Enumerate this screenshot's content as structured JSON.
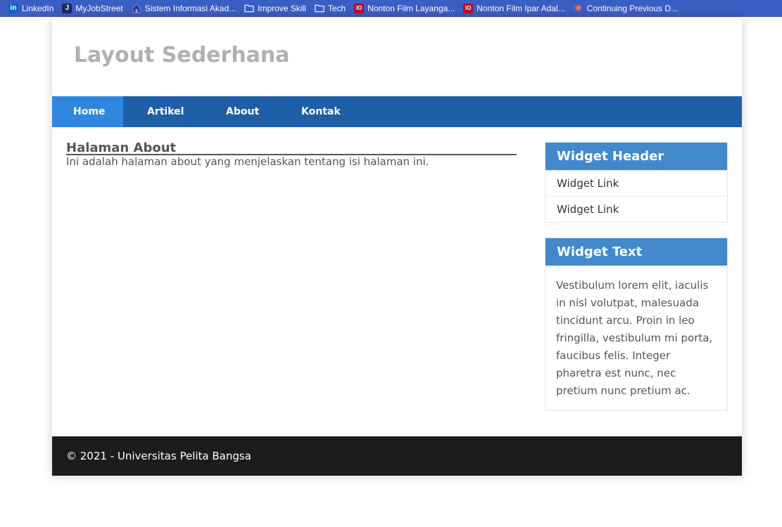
{
  "bookmarks": [
    {
      "label": "LinkedIn",
      "icon": "linkedin-icon"
    },
    {
      "label": "MyJobStreet",
      "icon": "jobstreet-icon"
    },
    {
      "label": "Sistem Informasi Akad...",
      "icon": "campus-icon"
    },
    {
      "label": "Improve Skill",
      "icon": "folder-icon"
    },
    {
      "label": "Tech",
      "icon": "folder-icon"
    },
    {
      "label": "Nonton Film Layanga...",
      "icon": "io-icon"
    },
    {
      "label": "Nonton Film Ipar Adal...",
      "icon": "io-icon"
    },
    {
      "label": "Continuing Previous D...",
      "icon": "starburst-icon"
    }
  ],
  "header": {
    "title": "Layout Sederhana"
  },
  "nav": {
    "home": "Home",
    "artikel": "Artikel",
    "about": "About",
    "kontak": "Kontak",
    "active": "Home"
  },
  "content": {
    "heading": "Halaman About",
    "body": "Ini adalah halaman about yang menjelaskan tentang isi halaman ini."
  },
  "sidebar": {
    "widget1": {
      "header": "Widget Header",
      "links": [
        "Widget Link",
        "Widget Link"
      ]
    },
    "widget2": {
      "header": "Widget Text",
      "text": "Vestibulum lorem elit, iaculis in nisl volutpat, malesuada tincidunt arcu. Proin in leo fringilla, vestibulum mi porta, faucibus felis. Integer pharetra est nunc, nec pretium nunc pretium ac."
    }
  },
  "footer": {
    "text": "© 2021 - Universitas Pelita Bangsa"
  },
  "colors": {
    "nav_bg": "#1f5fa8",
    "nav_active": "#2e86de",
    "widget_header": "#4189cb",
    "footer_bg": "#1c1c1c",
    "title": "#b0b0b0"
  }
}
